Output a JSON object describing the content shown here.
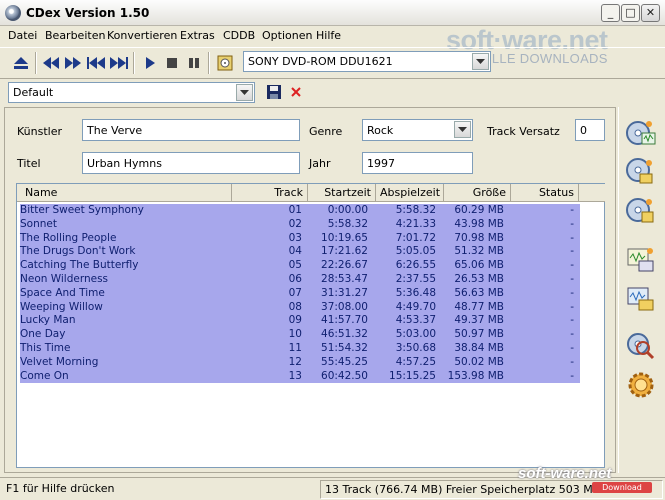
{
  "window": {
    "title": "CDex Version 1.50",
    "minimize": "_",
    "maximize": "□",
    "close": "✕"
  },
  "watermark": {
    "logo": "soft·ware.net",
    "tagline": "AKTUELLE DOWNLOADS"
  },
  "menu": [
    "Datei",
    "Bearbeiten",
    "Konvertieren",
    "Extras",
    "CDDB",
    "Optionen",
    "Hilfe"
  ],
  "toolbar": {
    "drive": "SONY    DVD-ROM DDU1621",
    "icons": [
      "eject-icon",
      "previous-track-icon",
      "next-track-icon",
      "skip-back-icon",
      "skip-forward-icon",
      "play-icon",
      "stop-icon",
      "pause-icon",
      "cd-info-icon"
    ]
  },
  "profile": {
    "selected": "Default"
  },
  "album": {
    "artist_label": "Künstler",
    "artist": "The Verve",
    "genre_label": "Genre",
    "genre": "Rock",
    "offset_label": "Track Versatz",
    "offset": "0",
    "title_label": "Titel",
    "title": "Urban Hymns",
    "year_label": "Jahr",
    "year": "1997"
  },
  "table": {
    "headers": {
      "name": "Name",
      "track": "Track",
      "start": "Startzeit",
      "length": "Abspielzeit",
      "size": "Größe",
      "status": "Status"
    },
    "rows": [
      {
        "name": "Bitter Sweet Symphony",
        "track": "01",
        "start": "0:00.00",
        "length": "5:58.32",
        "size": "60.29 MB",
        "status": "-"
      },
      {
        "name": "Sonnet",
        "track": "02",
        "start": "5:58.32",
        "length": "4:21.33",
        "size": "43.98 MB",
        "status": "-"
      },
      {
        "name": "The Rolling People",
        "track": "03",
        "start": "10:19.65",
        "length": "7:01.72",
        "size": "70.98 MB",
        "status": "-"
      },
      {
        "name": "The Drugs Don't Work",
        "track": "04",
        "start": "17:21.62",
        "length": "5:05.05",
        "size": "51.32 MB",
        "status": "-"
      },
      {
        "name": "Catching The Butterfly",
        "track": "05",
        "start": "22:26.67",
        "length": "6:26.55",
        "size": "65.06 MB",
        "status": "-"
      },
      {
        "name": "Neon Wilderness",
        "track": "06",
        "start": "28:53.47",
        "length": "2:37.55",
        "size": "26.53 MB",
        "status": "-"
      },
      {
        "name": "Space And Time",
        "track": "07",
        "start": "31:31.27",
        "length": "5:36.48",
        "size": "56.63 MB",
        "status": "-"
      },
      {
        "name": "Weeping Willow",
        "track": "08",
        "start": "37:08.00",
        "length": "4:49.70",
        "size": "48.77 MB",
        "status": "-"
      },
      {
        "name": "Lucky Man",
        "track": "09",
        "start": "41:57.70",
        "length": "4:53.37",
        "size": "49.37 MB",
        "status": "-"
      },
      {
        "name": "One Day",
        "track": "10",
        "start": "46:51.32",
        "length": "5:03.00",
        "size": "50.97 MB",
        "status": "-"
      },
      {
        "name": "This Time",
        "track": "11",
        "start": "51:54.32",
        "length": "3:50.68",
        "size": "38.84 MB",
        "status": "-"
      },
      {
        "name": "Velvet Morning",
        "track": "12",
        "start": "55:45.25",
        "length": "4:57.25",
        "size": "50.02 MB",
        "status": "-"
      },
      {
        "name": "Come On",
        "track": "13",
        "start": "60:42.50",
        "length": "15:15.25",
        "size": "153.98 MB",
        "status": "-"
      }
    ]
  },
  "status": {
    "help": "F1 für Hilfe drücken",
    "summary": "13 Track (766.74 MB) Freier Speicherplatz  503 MB",
    "badge": "soft-ware.net",
    "badge_sub": "Download"
  },
  "colors": {
    "selection": "#a7a7ec",
    "selection_text": "#102070"
  }
}
